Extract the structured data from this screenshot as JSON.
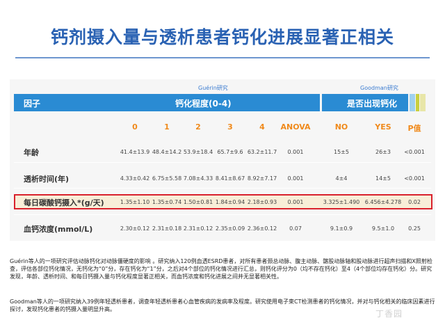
{
  "title": "钙剂摄入量与透析患者钙化进展显著正相关",
  "table": {
    "group_guerin": "Guérin研究",
    "group_goodman": "Goodman研究",
    "header": {
      "factor": "因子",
      "calcification_degree": "钙化程度(0-4)",
      "calcification_present": "是否出现钙化"
    },
    "subheaders": [
      "0",
      "1",
      "2",
      "3",
      "4",
      "ANOVA",
      "NO",
      "YES",
      "P值"
    ],
    "rows": [
      {
        "label": "年龄",
        "values": [
          "41.4±13.9",
          "48.4±14.2",
          "53.9±18.4",
          "65.7±9.6",
          "63.2±11.7",
          "0.001",
          "15±5",
          "26±3",
          "<0.001"
        ]
      },
      {
        "label": "透析时间(年)",
        "values": [
          "4.33±0.42",
          "6.75±5.58",
          "7.08±4.33",
          "8.41±8.67",
          "8.92±7.17",
          "0.001",
          "4±4",
          "14±5",
          "<0.001"
        ]
      },
      {
        "label": "每日碳酸钙摄入*(g/天)",
        "values": [
          "1.35±1.10",
          "1.35±0.74",
          "1.50±0.81",
          "1.84±0.94",
          "2.18±0.93",
          "0.001",
          "3.325±1.490",
          "6.456±4.278",
          "0.02"
        ]
      },
      {
        "label": "血钙浓度(mmol/L)",
        "values": [
          "2.30±0.12",
          "2.31±0.18",
          "2.31±0.12",
          "2.35±0.09",
          "2.36±0.12",
          "0.07",
          "9.1±0.9",
          "9.5±1.0",
          "0.25"
        ]
      }
    ]
  },
  "paragraphs": [
    "Guérin等人的一项研究评估动脉钙化对动脉僵硬度的影响 。研究纳入120例血透ESRD患者，对所有患者颈总动脉、腹主动脉、髂股动脉轴和股动脉进行超声扫描和X照射检查，评估各部位钙化情况，无钙化为“0”分，存在钙化为“1”分，之后对4个部位的钙化情况进行汇总，则钙化评分为0（均不存在钙化）至4（4个部位均存在钙化）分。研究发现，年龄、透析时间、和每日钙摄入量与钙化程度显著正相关，而血钙浓度和钙化进展之间并无显著相关性。",
    "Goodman等人的一项研究纳入39例年轻透析患者，调查年轻透析患者心血管疾病的发病率及程度。研究使用电子束CT检测患者的钙化情况，并对与钙化相关的临床因素进行探讨，发现钙化患者的钙摄入量明显升高。"
  ],
  "watermark": "丁香园",
  "colors": {
    "title": "#2a62b3",
    "header": "#2a8bd3",
    "subheader": "#f08a1c",
    "highlight": "#d9212c"
  }
}
